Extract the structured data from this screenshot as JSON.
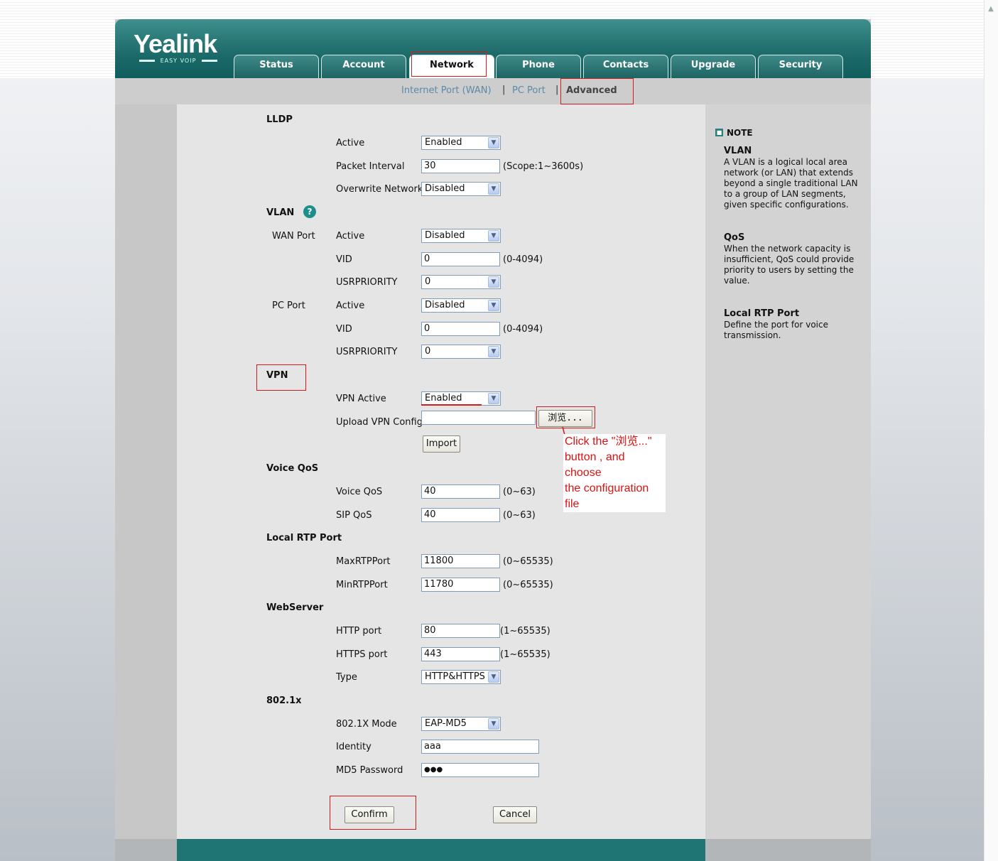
{
  "brand": {
    "logo_text": "Yealink",
    "logo_sub": "EASY VOIP"
  },
  "tabs": [
    {
      "label": "Status"
    },
    {
      "label": "Account"
    },
    {
      "label": "Network"
    },
    {
      "label": "Phone"
    },
    {
      "label": "Contacts"
    },
    {
      "label": "Upgrade"
    },
    {
      "label": "Security"
    }
  ],
  "subnav": {
    "wan": "Internet Port (WAN)",
    "pc": "PC Port",
    "advanced": "Advanced",
    "sep": "|"
  },
  "lldp": {
    "title": "LLDP",
    "active_label": "Active",
    "active_value": "Enabled",
    "interval_label": "Packet Interval",
    "interval_value": "30",
    "interval_hint": "(Scope:1~3600s)",
    "overwrite_label": "Overwrite Network",
    "overwrite_value": "Disabled"
  },
  "vlan": {
    "title": "VLAN",
    "help_icon": "?",
    "wan_group": "WAN Port",
    "wan_active_label": "Active",
    "wan_active_value": "Disabled",
    "wan_vid_label": "VID",
    "wan_vid_value": "0",
    "wan_vid_hint": "(0-4094)",
    "wan_prio_label": "USRPRIORITY",
    "wan_prio_value": "0",
    "pc_group": "PC Port",
    "pc_active_label": "Active",
    "pc_active_value": "Disabled",
    "pc_vid_label": "VID",
    "pc_vid_value": "0",
    "pc_vid_hint": "(0-4094)",
    "pc_prio_label": "USRPRIORITY",
    "pc_prio_value": "0"
  },
  "vpn": {
    "title": "VPN",
    "active_label": "VPN Active",
    "active_value": "Enabled",
    "upload_label": "Upload VPN Config",
    "upload_value": "",
    "browse_label": "浏览...",
    "import_label": "Import",
    "callout": [
      "Click the \"浏览...\"",
      "button , and choose",
      "the configuration file"
    ]
  },
  "voice_qos": {
    "title": "Voice QoS",
    "voice_label": "Voice QoS",
    "voice_value": "40",
    "voice_hint": "(0~63)",
    "sip_label": "SIP QoS",
    "sip_value": "40",
    "sip_hint": "(0~63)"
  },
  "rtp": {
    "title": "Local RTP Port",
    "max_label": "MaxRTPPort",
    "max_value": "11800",
    "max_hint": "(0~65535)",
    "min_label": "MinRTPPort",
    "min_value": "11780",
    "min_hint": "(0~65535)"
  },
  "webserver": {
    "title": "WebServer",
    "http_label": "HTTP port",
    "http_value": "80",
    "http_hint": "(1~65535)",
    "https_label": "HTTPS port",
    "https_value": "443",
    "https_hint": "(1~65535)",
    "type_label": "Type",
    "type_value": "HTTP&HTTPS"
  },
  "dot1x": {
    "title": "802.1x",
    "mode_label": "802.1X Mode",
    "mode_value": "EAP-MD5",
    "identity_label": "Identity",
    "identity_value": "aaa",
    "password_label": "MD5 Password",
    "password_value": "●●●"
  },
  "actions": {
    "confirm": "Confirm",
    "cancel": "Cancel"
  },
  "note": {
    "heading": "NOTE",
    "items": [
      {
        "title": "VLAN",
        "body": "A VLAN is a logical local area network (or LAN) that extends beyond a single traditional LAN to a group of LAN segments, given specific configurations."
      },
      {
        "title": "QoS",
        "body": "When the network capacity is insufficient, QoS could provide priority to users by setting the value."
      },
      {
        "title": "Local RTP Port",
        "body": "Define the port for voice transmission."
      }
    ]
  },
  "colors": {
    "header_teal": "#1c6a69",
    "annotation_red": "#d61a1a",
    "link_blue": "#5b8aa8"
  }
}
